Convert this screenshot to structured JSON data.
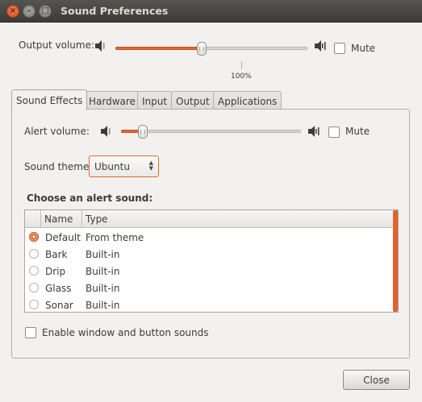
{
  "window": {
    "title": "Sound Preferences"
  },
  "output": {
    "label": "Output volume:",
    "level": 0.45,
    "mute_label": "Mute",
    "muted": false,
    "percent_label": "100%"
  },
  "tabs": [
    {
      "label": "Sound Effects",
      "active": true
    },
    {
      "label": "Hardware",
      "active": false
    },
    {
      "label": "Input",
      "active": false
    },
    {
      "label": "Output",
      "active": false
    },
    {
      "label": "Applications",
      "active": false
    }
  ],
  "effects": {
    "alert_label": "Alert volume:",
    "alert_level": 0.12,
    "mute_label": "Mute",
    "theme_label": "Sound theme:",
    "theme_value": "Ubuntu",
    "choose_heading": "Choose an alert sound:",
    "columns": {
      "name": "Name",
      "type": "Type"
    },
    "sounds": [
      {
        "name": "Default",
        "type": "From theme",
        "selected": true
      },
      {
        "name": "Bark",
        "type": "Built-in",
        "selected": false
      },
      {
        "name": "Drip",
        "type": "Built-in",
        "selected": false
      },
      {
        "name": "Glass",
        "type": "Built-in",
        "selected": false
      },
      {
        "name": "Sonar",
        "type": "Built-in",
        "selected": false
      }
    ],
    "window_sounds_label": "Enable window and button sounds",
    "window_sounds_enabled": false
  },
  "buttons": {
    "close": "Close"
  },
  "icons": {
    "close": "close-icon",
    "minimize": "minimize-icon",
    "maximize": "maximize-icon",
    "speaker_low": "speaker-low-icon",
    "speaker_high": "speaker-high-icon"
  },
  "colors": {
    "accent": "#e26a33",
    "titlebar": "#3c3b37"
  }
}
